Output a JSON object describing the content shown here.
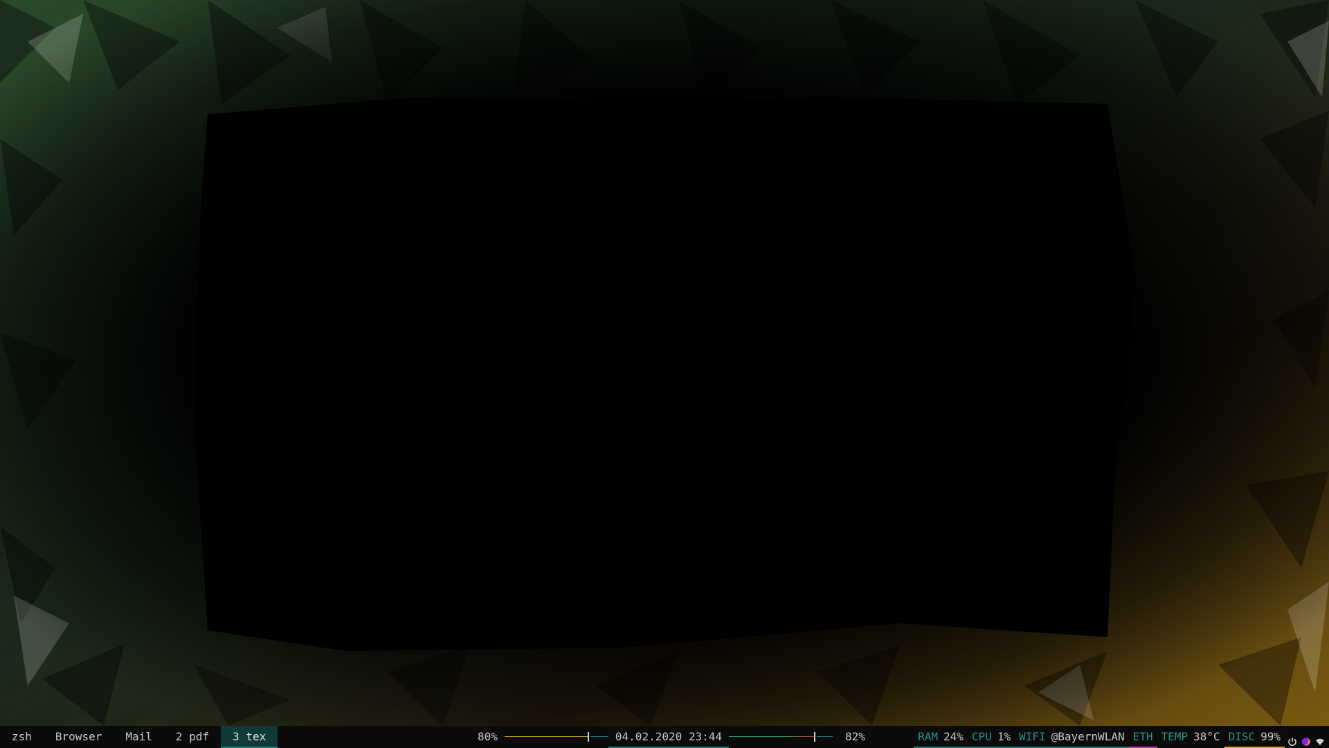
{
  "colors": {
    "accent_teal": "#1e7f77",
    "label_teal": "#2f8f87",
    "volume_line": "#c9a227",
    "brightness_line": "#2aa06a",
    "brightness_red": "#c0392b",
    "eth_underline": "#c033c0",
    "disc_underline": "#d4a21a"
  },
  "workspaces": [
    {
      "label": "zsh",
      "active": false
    },
    {
      "label": "Browser",
      "active": false
    },
    {
      "label": "Mail",
      "active": false
    },
    {
      "label": "2 pdf",
      "active": false
    },
    {
      "label": "3 tex",
      "active": true
    }
  ],
  "center": {
    "volume": "80%",
    "volume_level": 0.8,
    "datetime": "04.02.2020 23:44",
    "brightness": "82%",
    "brightness_level": 0.82
  },
  "modules": {
    "ram_label": "RAM",
    "ram_value": "24%",
    "cpu_label": "CPU",
    "cpu_value": "1%",
    "wifi_label": "WIFI",
    "wifi_value": "@BayernWLAN",
    "eth_label": "ETH",
    "temp_label": "TEMP",
    "temp_value": "38°C",
    "disc_label": "DISC",
    "disc_value": "99%"
  },
  "tray": [
    "power-icon",
    "firefox-icon",
    "wifi-icon"
  ]
}
